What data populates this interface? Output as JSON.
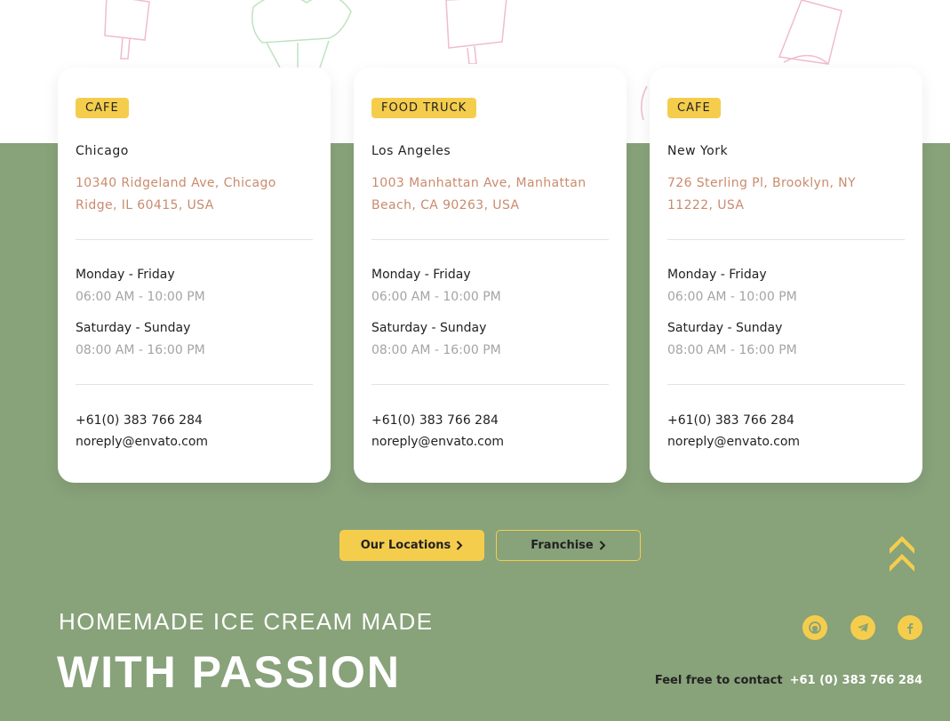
{
  "cards": [
    {
      "tag": "CAFE",
      "city": "Chicago",
      "address": "10340 Ridgeland Ave, Chicago Ridge, IL 60415, USA",
      "weekday_label": "Monday - Friday",
      "weekday_hours": "06:00 AM - 10:00 PM",
      "weekend_label": "Saturday - Sunday",
      "weekend_hours": "08:00 AM - 16:00 PM",
      "phone": "+61(0) 383 766 284",
      "email": "noreply@envato.com"
    },
    {
      "tag": "FOOD TRUCK",
      "city": "Los Angeles",
      "address": "1003 Manhattan Ave, Manhattan Beach, CA 90263, USA",
      "weekday_label": "Monday - Friday",
      "weekday_hours": "06:00 AM - 10:00 PM",
      "weekend_label": "Saturday - Sunday",
      "weekend_hours": "08:00 AM - 16:00 PM",
      "phone": "+61(0) 383 766 284",
      "email": "noreply@envato.com"
    },
    {
      "tag": "CAFE",
      "city": "New York",
      "address": "726 Sterling Pl, Brooklyn, NY 11222, USA",
      "weekday_label": "Monday - Friday",
      "weekday_hours": "06:00 AM - 10:00 PM",
      "weekend_label": "Saturday - Sunday",
      "weekend_hours": "08:00 AM - 16:00 PM",
      "phone": "+61(0) 383 766 284",
      "email": "noreply@envato.com"
    }
  ],
  "buttons": {
    "locations_label": "Our Locations",
    "franchise_label": "Franchise"
  },
  "hero": {
    "line1": "HOMEMADE ICE CREAM MADE",
    "line2": "WITH PASSION"
  },
  "contact": {
    "label": "Feel free to contact",
    "phone": "+61 (0) 383 766 284"
  },
  "icons": {
    "social": [
      "github-icon",
      "telegram-icon",
      "facebook-icon"
    ],
    "scroll_top": "double-chevron-up-icon"
  },
  "colors": {
    "green_background": "#88a27a",
    "accent_yellow": "#f5cd4d",
    "address_text": "#c98b6d",
    "hours_text": "#a4a4a4"
  }
}
